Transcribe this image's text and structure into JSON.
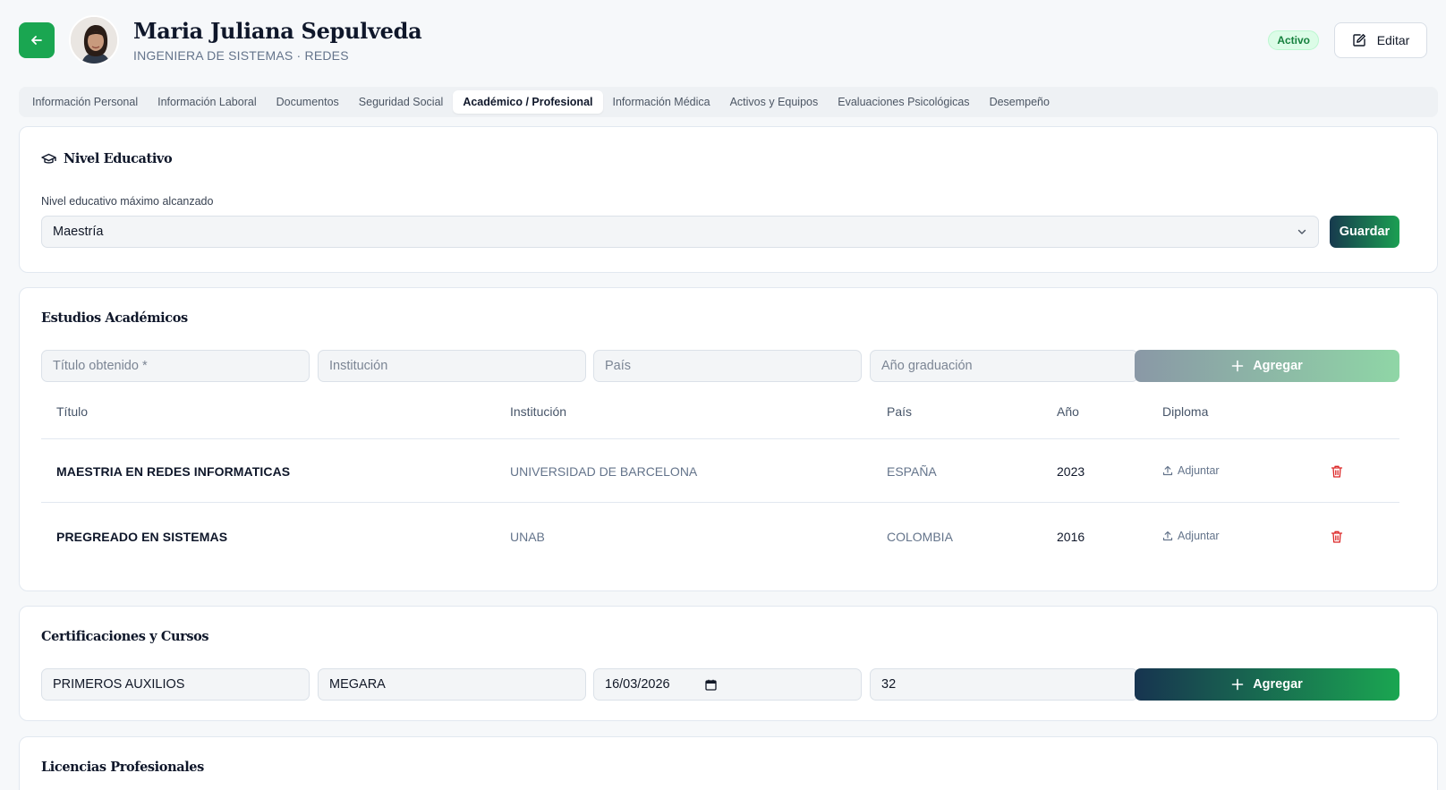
{
  "profile": {
    "name": "Maria Juliana Sepulveda",
    "subtitle": "INGENIERA DE SISTEMAS · REDES",
    "status": "Activo",
    "edit_label": "Editar"
  },
  "tabs": [
    {
      "label": "Información Personal"
    },
    {
      "label": "Información Laboral"
    },
    {
      "label": "Documentos"
    },
    {
      "label": "Seguridad Social"
    },
    {
      "label": "Académico / Profesional",
      "active": true
    },
    {
      "label": "Información Médica"
    },
    {
      "label": "Activos y Equipos"
    },
    {
      "label": "Evaluaciones Psicológicas"
    },
    {
      "label": "Desempeño"
    }
  ],
  "nivel": {
    "title": "Nivel Educativo",
    "field_label": "Nivel educativo máximo alcanzado",
    "selected": "Maestría",
    "save_label": "Guardar"
  },
  "estudios": {
    "title": "Estudios Académicos",
    "placeholders": {
      "titulo": "Título obtenido *",
      "institucion": "Institución",
      "pais": "País",
      "anio": "Año graduación"
    },
    "add_label": "Agregar",
    "columns": [
      "Título",
      "Institución",
      "País",
      "Año",
      "Diploma"
    ],
    "attach_label": "Adjuntar",
    "rows": [
      {
        "titulo": "MAESTRIA EN REDES INFORMATICAS",
        "institucion": "UNIVERSIDAD DE BARCELONA",
        "pais": "ESPAÑA",
        "anio": "2023"
      },
      {
        "titulo": "PREGREADO EN SISTEMAS",
        "institucion": "UNAB",
        "pais": "COLOMBIA",
        "anio": "2016"
      }
    ]
  },
  "certificaciones": {
    "title": "Certificaciones y Cursos",
    "values": {
      "nombre": "PRIMEROS AUXILIOS",
      "entidad": "MEGARA",
      "fecha": "16/03/2026",
      "horas": "32"
    },
    "add_label": "Agregar"
  },
  "licencias": {
    "title": "Licencias Profesionales"
  },
  "colors": {
    "accent_green": "#1aa651",
    "accent_navy": "#173450",
    "danger": "#dc2626"
  }
}
